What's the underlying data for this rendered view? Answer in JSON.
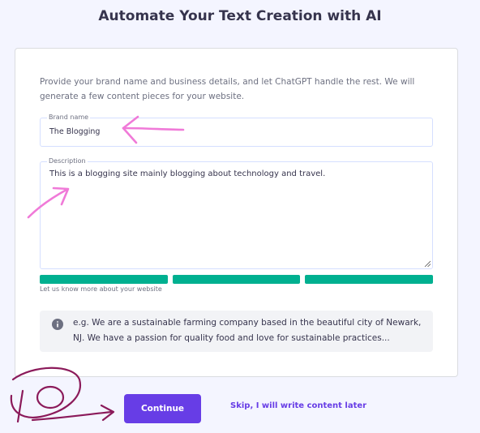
{
  "page": {
    "title": "Automate Your Text Creation with AI"
  },
  "form": {
    "intro": "Provide your brand name and business details, and let ChatGPT handle the rest. We will generate a few content pieces for your website.",
    "brand_name": {
      "label": "Brand name",
      "value": "The Blogging"
    },
    "description": {
      "label": "Description",
      "value": "This is a blogging site mainly blogging about technology and travel."
    },
    "helper": "Let us know more about your website",
    "progress": {
      "filled_segments": 3,
      "total_segments": 3
    },
    "example": "e.g. We are a sustainable farming company based in the beautiful city of Newark, NJ. We have a passion for quality food and love for sustainable practices..."
  },
  "actions": {
    "continue_label": "Continue",
    "skip_label": "Skip, I will write content later"
  },
  "colors": {
    "accent": "#673de6",
    "progress": "#00b090",
    "annotation_pink": "#f07ad8",
    "annotation_maroon": "#8b1a5a"
  },
  "annotations": {
    "step_number": "10"
  }
}
